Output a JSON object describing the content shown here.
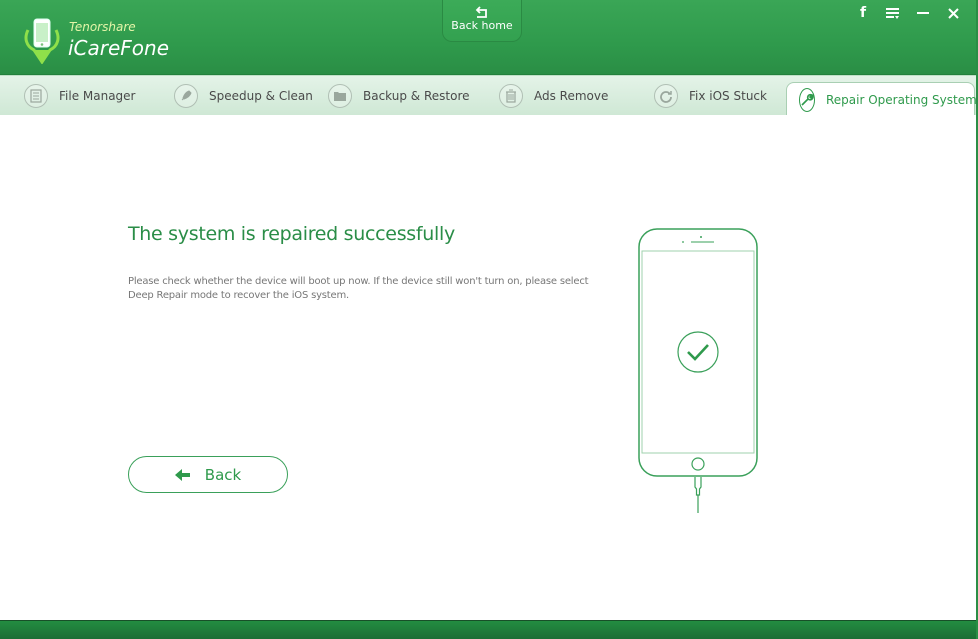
{
  "app": {
    "vendor": "Tenorshare",
    "name": "iCareFone",
    "accent_color": "#2f9a4c"
  },
  "header": {
    "back_home_label": "Back home",
    "controls": [
      {
        "name": "facebook",
        "glyph": "f"
      },
      {
        "name": "menu",
        "glyph": "≡"
      },
      {
        "name": "minimize",
        "glyph": "—"
      },
      {
        "name": "close",
        "glyph": "✕"
      }
    ]
  },
  "tabs": [
    {
      "label": "File Manager",
      "icon": "file-list-icon",
      "active": false
    },
    {
      "label": "Speedup & Clean",
      "icon": "rocket-icon",
      "active": false
    },
    {
      "label": "Backup & Restore",
      "icon": "folder-icon",
      "active": false
    },
    {
      "label": "Ads Remove",
      "icon": "trash-icon",
      "active": false
    },
    {
      "label": "Fix iOS Stuck",
      "icon": "refresh-icon",
      "active": false
    },
    {
      "label": "Repair Operating System",
      "icon": "wrench-icon",
      "active": true
    }
  ],
  "main": {
    "title": "The system is repaired successfully",
    "description": "Please check whether the device will boot up now. If the device still won't turn on, please select Deep Repair mode to recover the iOS system.",
    "back_button_label": "Back",
    "status": "success"
  }
}
